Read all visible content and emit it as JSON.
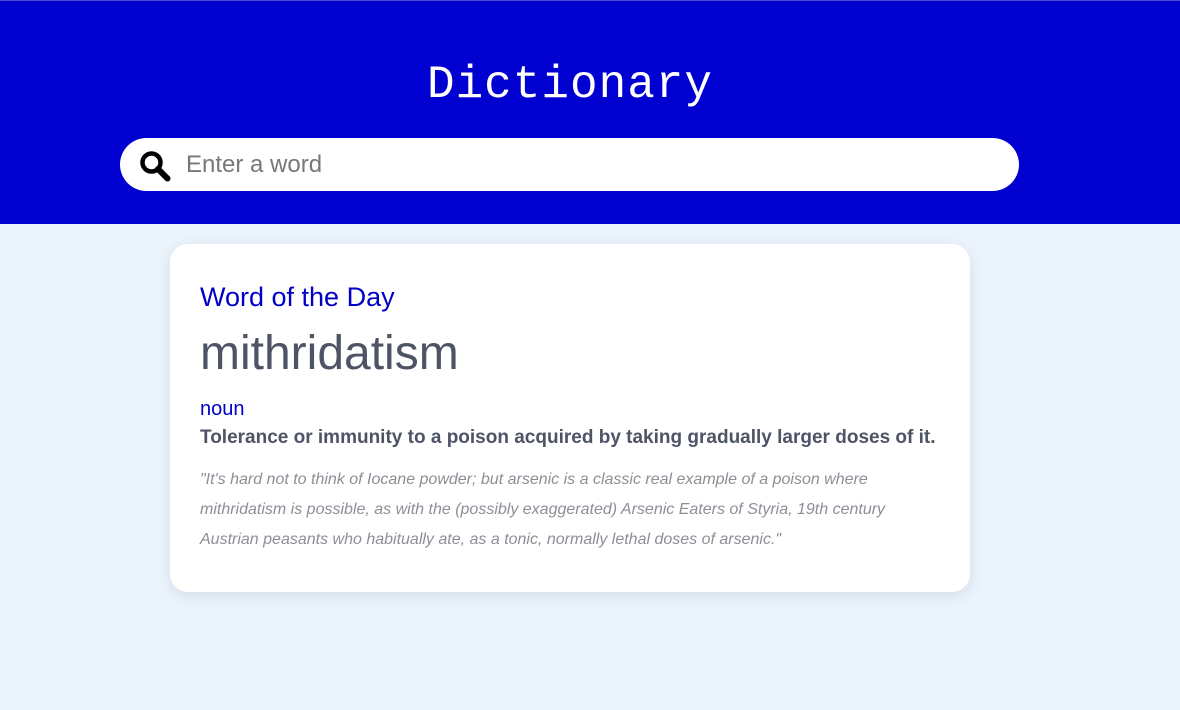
{
  "header": {
    "title": "Dictionary",
    "background_color": "#0000d1"
  },
  "search": {
    "placeholder": "Enter a word",
    "value": "",
    "icon": "search-icon"
  },
  "word_of_the_day": {
    "heading": "Word of the Day",
    "word": "mithridatism",
    "part_of_speech": "noun",
    "definition": "Tolerance or immunity to a poison acquired by taking gradually larger doses of it.",
    "example": "\"It's hard not to think of Iocane powder; but arsenic is a classic real example of a poison where mithridatism is possible, as with the (possibly exaggerated) Arsenic Eaters of Styria, 19th century Austrian peasants who habitually ate, as a tonic, normally lethal doses of arsenic.\""
  },
  "colors": {
    "accent": "#0000c8",
    "page_background": "#ebf3fb",
    "text": "#4e5466",
    "muted_text": "#8d8f97"
  }
}
